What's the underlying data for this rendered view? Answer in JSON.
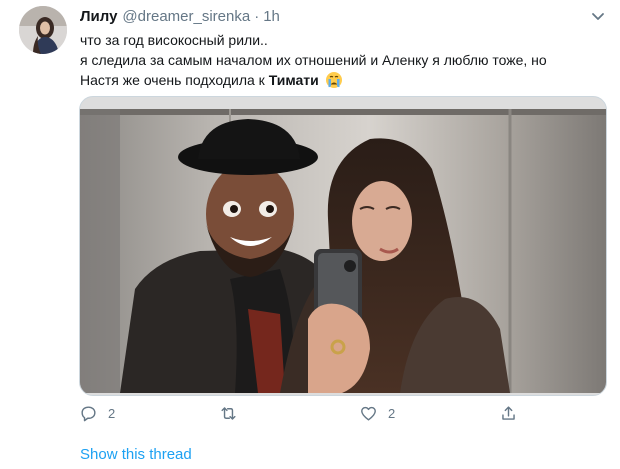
{
  "tweet": {
    "author_name": "Лилу",
    "author_handle": "@dreamer_sirenka",
    "separator": "·",
    "timestamp": "1h",
    "text_line_1": "что за год високосный рили..",
    "text_line_2": "я следила за самым началом их отношений и Аленку я люблю тоже, но",
    "text_line_3_prefix": "Настя же очень подходила к ",
    "text_line_3_bold": "Тимати",
    "emoji": "crying-face"
  },
  "actions": {
    "reply_count": "2",
    "retweet_count": "",
    "like_count": "2"
  },
  "footer": {
    "show_thread": "Show this thread"
  },
  "colors": {
    "link": "#1da1f2",
    "secondary_text": "#657786",
    "border": "#ccd6dd"
  },
  "icons": [
    "chevron-down-icon",
    "reply-icon",
    "retweet-icon",
    "like-icon",
    "share-icon"
  ]
}
